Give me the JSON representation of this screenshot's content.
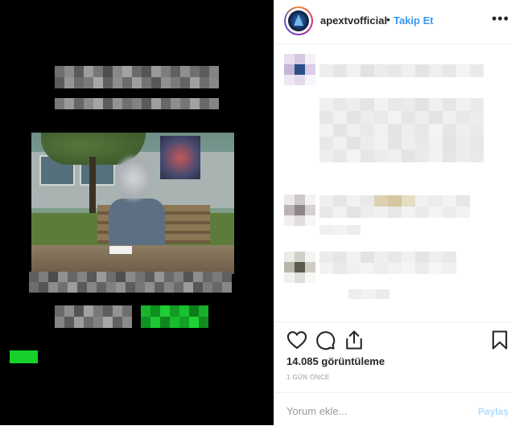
{
  "header": {
    "username": "apextvofficial",
    "separator": "•",
    "follow_label": "Takip Et",
    "more_icon": "more-horizontal-icon"
  },
  "media": {
    "description_hidden": true
  },
  "actions": {
    "like_icon": "heart-icon",
    "comment_icon": "comment-icon",
    "share_icon": "share-icon",
    "save_icon": "bookmark-icon"
  },
  "stats": {
    "views": "14.085 görüntüleme",
    "time_ago": "1 GÜN ÖNCE"
  },
  "comment_box": {
    "placeholder": "Yorum ekle...",
    "post_label": "Paylaş"
  },
  "colors": {
    "accent": "#3897f0",
    "text": "#262626",
    "muted": "#999999",
    "highlight_green": "#17d12a"
  }
}
